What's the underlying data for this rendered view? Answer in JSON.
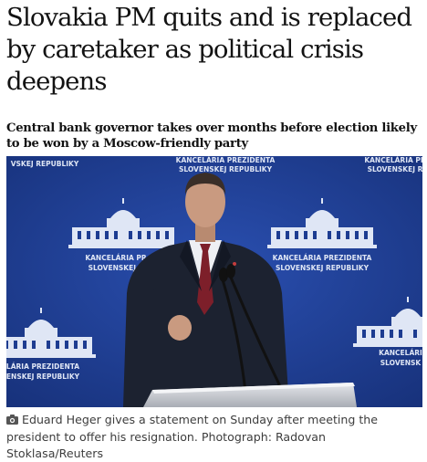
{
  "article": {
    "headline": "Slovakia PM quits and is replaced by caretaker as political crisis deepens",
    "standfirst": "Central bank governor takes over months before election likely to be won by a Moscow-friendly party"
  },
  "photo": {
    "backdrop_lines": {
      "top_left": "VSKEJ REPUBLIKY",
      "top_center_1": "KANCELÁRIA PREZIDENTA",
      "top_center_2": "SLOVENSKEJ REPUBLIKY",
      "top_right_1": "KANCELÁRIA PR",
      "top_right_2": "SLOVENSKEJ R",
      "mid_left_1": "KANCELÁRIA PR",
      "mid_left_2": "SLOVENSKEJ R",
      "mid_right_1": "KANCELÁRIA PREZIDENTA",
      "mid_right_2": "SLOVENSKEJ REPUBLIKY",
      "bottom_left_1": "LÁRIA PREZIDENTA",
      "bottom_left_2": "ENSKEJ REPUBLIKY",
      "bottom_right_1": "KANCELÁRI",
      "bottom_right_2": "SLOVENSK"
    },
    "colors": {
      "backdrop": "#1d3c91",
      "emblem": "#dfe6f5",
      "suit": "#1c2230",
      "tie": "#7d1f2a",
      "skin": "#c99a80"
    }
  },
  "caption": {
    "icon": "camera-icon",
    "text": "Eduard Heger gives a statement on Sunday after meeting the president to offer his resignation. Photograph: Radovan Stoklasa/Reuters"
  }
}
